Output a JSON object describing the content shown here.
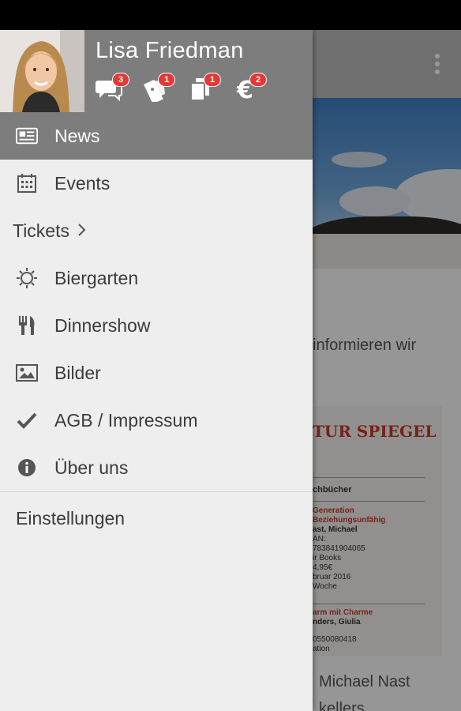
{
  "user": {
    "name": "Lisa Friedman",
    "badges": [
      {
        "icon": "chat-icon",
        "count": "3"
      },
      {
        "icon": "ticket-icon",
        "count": "1"
      },
      {
        "icon": "copy-icon",
        "count": "1"
      },
      {
        "icon": "euro-icon",
        "count": "2"
      }
    ]
  },
  "nav": {
    "items": [
      {
        "label": "News",
        "icon": "newspaper-icon",
        "active": true
      },
      {
        "label": "Events",
        "icon": "calendar-icon"
      },
      {
        "label": "Tickets",
        "icon": "chevron-right-icon",
        "section": true
      },
      {
        "label": "Biergarten",
        "icon": "sun-icon"
      },
      {
        "label": "Dinnershow",
        "icon": "cutlery-icon"
      },
      {
        "label": "Bilder",
        "icon": "image-icon"
      },
      {
        "label": "AGB / Impressum",
        "icon": "check-icon"
      },
      {
        "label": "Über uns",
        "icon": "info-icon"
      }
    ],
    "settings": "Einstellungen"
  },
  "background": {
    "text_line1": "informieren wir",
    "magazine_title": "TUR SPIEGEL",
    "magazine_header": "chbücher",
    "book1_title_a": "Generation",
    "book1_title_b": "Beziehungsunfähig",
    "book1_author": "ast, Michael",
    "book1_isbn_label": "AN:",
    "book1_isbn": "783841904065",
    "book1_publisher": "ir Books",
    "book1_price": "4,95€",
    "book1_date": "bruar 2016",
    "book1_week": "Woche",
    "book2_title": "arm mit Charme",
    "book2_author": "nders, Giulia",
    "book2_isbn": "0550080418",
    "book2_extra": "ation",
    "below_text1": "Michael Nast",
    "below_text2": "kellers"
  },
  "colors": {
    "header_bg": "#7d7d7d",
    "drawer_bg": "#eeeeee",
    "badge": "#e53935",
    "magazine_red": "#c4392b"
  }
}
